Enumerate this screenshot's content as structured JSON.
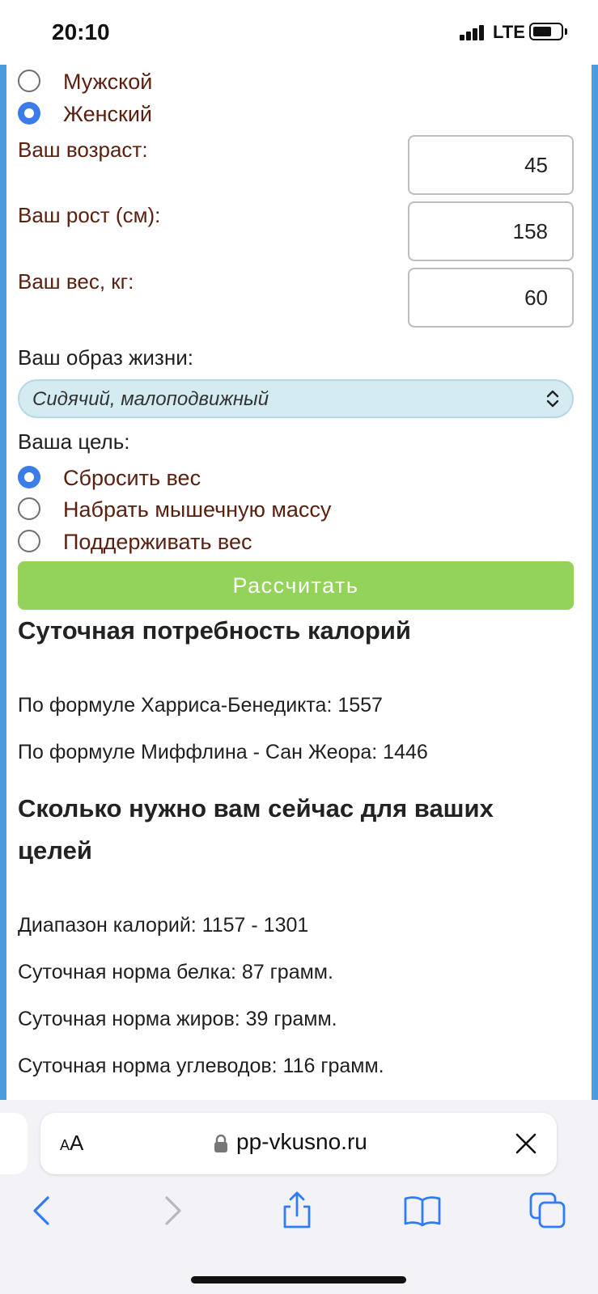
{
  "status_bar": {
    "time": "20:10",
    "network": "LTE"
  },
  "form": {
    "gender": [
      {
        "label": "Мужской",
        "checked": false
      },
      {
        "label": "Женский",
        "checked": true
      }
    ],
    "age": {
      "label": "Ваш возраст:",
      "value": "45"
    },
    "height": {
      "label": "Ваш рост (см):",
      "value": "158"
    },
    "weight": {
      "label": "Ваш вес, кг:",
      "value": "60"
    },
    "lifestyle": {
      "label": "Ваш образ жизни:",
      "selected": "Сидячий, малоподвижный"
    },
    "goal": {
      "label": "Ваша цель:",
      "options": [
        {
          "label": "Сбросить вес",
          "checked": true
        },
        {
          "label": "Набрать мышечную массу",
          "checked": false
        },
        {
          "label": "Поддерживать вес",
          "checked": false
        }
      ]
    },
    "calculate_label": "Рассчитать"
  },
  "results": {
    "daily_heading": "Суточная потребность калорий",
    "harris": "По формуле Харриса-Бенедикта: 1557",
    "mifflin": "По формуле Миффлина - Сан Жеора: 1446",
    "goals_heading_line1": "Сколько нужно вам сейчас для ваших",
    "goals_heading_line2": "целей",
    "range": "Диапазон калорий: 1157 - 1301",
    "protein": "Суточная норма белка: 87 грамм.",
    "fat": "Суточная норма жиров: 39 грамм.",
    "carbs": "Суточная норма углеводов: 116 грамм."
  },
  "browser": {
    "aa_small": "A",
    "aa_large": "A",
    "url": "pp-vkusno.ru"
  },
  "colors": {
    "accent_blue": "#3b7de8",
    "frame_blue": "#4a9be0",
    "button_green": "#93d35a",
    "label_brown": "#5a2010",
    "select_bg": "#d4ebf1"
  }
}
